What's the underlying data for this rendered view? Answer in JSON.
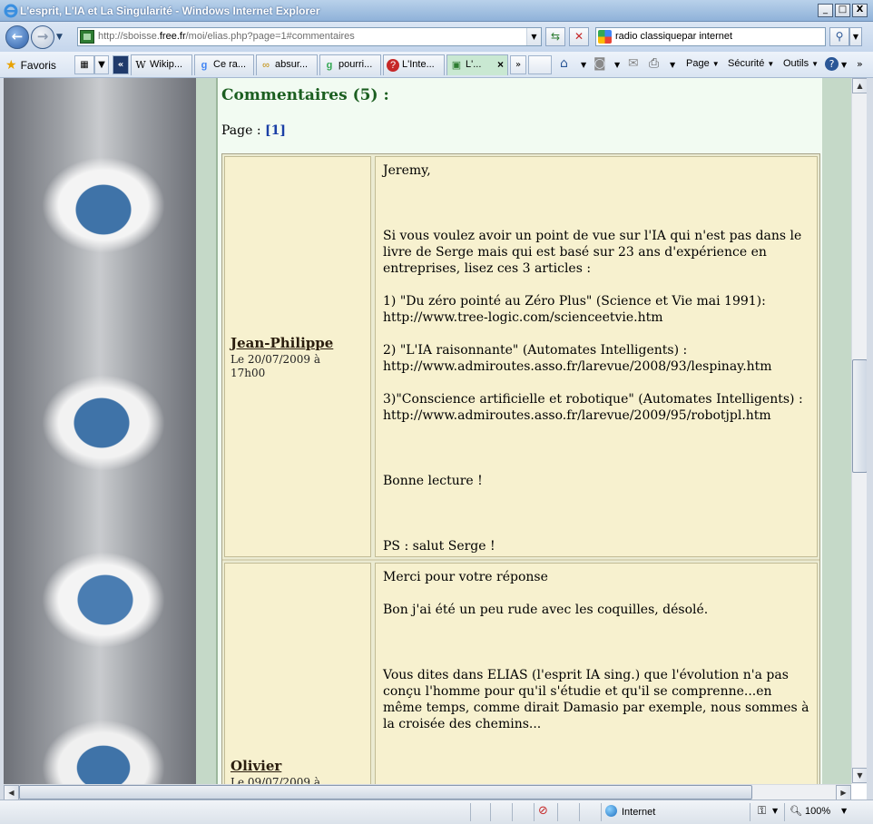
{
  "window": {
    "title": "L'esprit, L'IA et La Singularité - Windows Internet Explorer",
    "min_label": "_",
    "max_label": "□",
    "close_label": "X"
  },
  "address": {
    "url_prefix": "http://sboisse.",
    "url_domain": "free.fr",
    "url_suffix": "/moi/elias.php?page=1#commentaires",
    "search_value": "radio classiquepar internet"
  },
  "favorites": {
    "label": "Favoris",
    "tabs": [
      {
        "label": "Wikip...",
        "icon": "W"
      },
      {
        "label": "Ce ra...",
        "icon": "g"
      },
      {
        "label": "absur...",
        "icon": "∞"
      },
      {
        "label": "pourri...",
        "icon": "g"
      },
      {
        "label": "L'Inte...",
        "icon": "?"
      },
      {
        "label": "L'...",
        "icon": "▣",
        "active": true
      }
    ],
    "more": "»",
    "commands": {
      "page": "Page",
      "security": "Sécurité",
      "tools": "Outils"
    }
  },
  "content": {
    "heading": "Commentaires (5) :",
    "pager_label": "Page : ",
    "pager_current": "[1]",
    "comments": [
      {
        "author": "Jean-Philippe",
        "date": "Le 20/07/2009 à 17h00",
        "body": "Jeremy,\n\n\n\nSi vous voulez avoir un point de vue sur l'IA qui n'est pas dans le livre de Serge mais qui est basé sur 23 ans d'expérience en entreprises, lisez ces 3 articles :\n\n1) \"Du zéro pointé au Zéro Plus\" (Science et Vie mai 1991):\nhttp://www.tree-logic.com/scienceetvie.htm\n\n2) \"L'IA raisonnante\" (Automates Intelligents) :\nhttp://www.admiroutes.asso.fr/larevue/2008/93/lespinay.htm\n\n3)\"Conscience artificielle et robotique\" (Automates Intelligents) :\nhttp://www.admiroutes.asso.fr/larevue/2009/95/robotjpl.htm\n\n\n\nBonne lecture !\n\n\n\nPS : salut Serge !"
      },
      {
        "author": "Olivier",
        "date": "Le 09/07/2009 à",
        "body": "Merci pour votre réponse\n\nBon j'ai été un peu rude avec les coquilles, désolé.\n\n\n\nVous dites dans ELIAS (l'esprit IA sing.) que l'évolution n'a pas conçu l'homme pour qu'il s'étudie et qu'il se comprenne...en même temps, comme dirait Damasio par exemple, nous sommes à la croisée des chemins..."
      }
    ]
  },
  "status": {
    "zone": "Internet",
    "zoom": "100%"
  }
}
